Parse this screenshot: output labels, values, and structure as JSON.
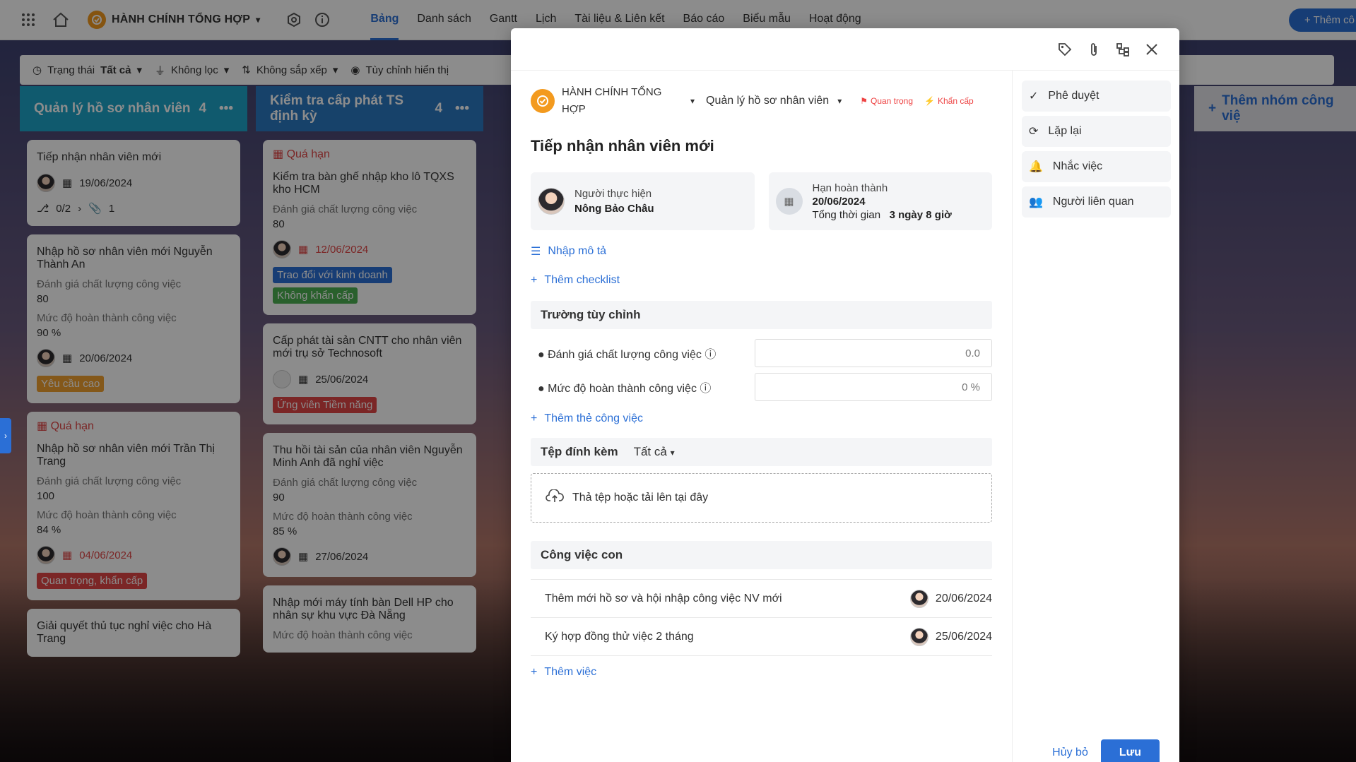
{
  "nav": {
    "project_name": "HÀNH CHÍNH TỔNG HỢP",
    "tabs": [
      "Bảng",
      "Danh sách",
      "Gantt",
      "Lịch",
      "Tài liệu & Liên kết",
      "Báo cáo",
      "Biểu mẫu",
      "Hoạt động"
    ],
    "active_tab": "Bảng",
    "add_button": "Thêm cô"
  },
  "filters": {
    "status_label": "Trạng thái",
    "status_value": "Tất cả",
    "filter": "Không lọc",
    "sort": "Không sắp xếp",
    "display": "Tùy chỉnh hiển thị"
  },
  "columns": [
    {
      "title": "Quản lý hồ sơ nhân viên",
      "count": "4",
      "color": "#1ea5c8"
    },
    {
      "title": "Kiểm tra cấp phát TS định kỳ",
      "count": "4",
      "color": "#2b78c2"
    }
  ],
  "add_group": "Thêm nhóm công việ",
  "col1_cards": [
    {
      "title": "Tiếp nhận nhân viên mới",
      "date": "19/06/2024",
      "subtasks": "0/2",
      "attachments": "1"
    },
    {
      "title": "Nhập hồ sơ nhân viên mới Nguyễn Thành An",
      "metric1_label": "Đánh giá chất lượng công việc",
      "metric1_value": "80",
      "metric2_label": "Mức độ hoàn thành công việc",
      "metric2_value": "90 %",
      "date": "20/06/2024",
      "tag": "Yêu cầu cao"
    },
    {
      "status": "Quá hạn",
      "title": "Nhập hồ sơ nhân viên mới Trần Thị Trang",
      "metric1_label": "Đánh giá chất lượng công việc",
      "metric1_value": "100",
      "metric2_label": "Mức độ hoàn thành công việc",
      "metric2_value": "84 %",
      "date": "04/06/2024",
      "tag": "Quan trọng, khẩn cấp"
    },
    {
      "title": "Giải quyết thủ tục nghỉ việc cho Hà Trang"
    }
  ],
  "col2_cards": [
    {
      "status": "Quá hạn",
      "title": "Kiểm tra bàn ghế nhập kho lô TQXS kho HCM",
      "metric1_label": "Đánh giá chất lượng công việc",
      "metric1_value": "80",
      "date": "12/06/2024",
      "tag1": "Trao đổi với kinh doanh",
      "tag2": "Không khẩn cấp"
    },
    {
      "title": "Cấp phát tài sản CNTT cho nhân viên mới trụ sở Technosoft",
      "date": "25/06/2024",
      "tag": "Ứng viên Tiềm năng"
    },
    {
      "title": "Thu hồi tài sản của nhân viên Nguyễn Minh Anh đã nghỉ việc",
      "metric1_label": "Đánh giá chất lượng công việc",
      "metric1_value": "90",
      "metric2_label": "Mức độ hoàn thành công việc",
      "metric2_value": "85 %",
      "date": "27/06/2024"
    },
    {
      "title": "Nhập mới máy tính bàn Dell HP cho nhân sự khu vực Đà Nẵng",
      "metric2_label": "Mức độ hoàn thành công việc"
    }
  ],
  "modal": {
    "project": "HÀNH CHÍNH TỔNG HỢP",
    "group": "Quản lý hồ sơ nhân viên",
    "badge_important": "Quan trọng",
    "badge_urgent": "Khẩn cấp",
    "title": "Tiếp nhận nhân viên mới",
    "assignee_label": "Người thực hiện",
    "assignee_name": "Nông Bảo Châu",
    "deadline_label": "Hạn hoàn thành",
    "deadline_value": "20/06/2024",
    "duration_label": "Tổng thời gian",
    "duration_value": "3 ngày 8 giờ",
    "add_description": "Nhập mô tả",
    "add_checklist": "Thêm checklist",
    "custom_fields_title": "Trường tùy chỉnh",
    "cf1_label": "Đánh giá chất lượng công việc",
    "cf1_value": "0.0",
    "cf2_label": "Mức độ hoàn thành công việc",
    "cf2_value": "0 %",
    "add_tag": "Thêm thẻ công việc",
    "attachments_title": "Tệp đính kèm",
    "attachments_filter": "Tất cả",
    "dropzone": "Thả tệp hoặc tải lên tại đây",
    "subtasks_title": "Công việc con",
    "subtasks": [
      {
        "title": "Thêm mới hồ sơ và hội nhập công việc NV mới",
        "date": "20/06/2024"
      },
      {
        "title": "Ký hợp đồng thử việc 2 tháng",
        "date": "25/06/2024"
      }
    ],
    "add_subtask": "Thêm việc",
    "side": [
      "Phê duyệt",
      "Lặp lại",
      "Nhắc việc",
      "Người liên quan"
    ],
    "cancel": "Hủy bỏ",
    "save": "Lưu"
  }
}
